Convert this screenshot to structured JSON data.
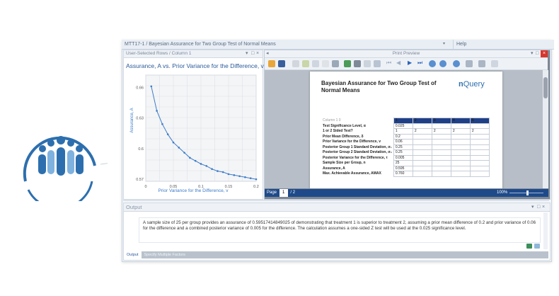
{
  "window": {
    "title": "MTT17-1 / Bayesian Assurance for Two Group Test of Normal Means",
    "help_label": "Help"
  },
  "chart_panel": {
    "header": "User-Selected Rows / Column 1"
  },
  "chart_data": {
    "type": "line",
    "title": "Assurance, A vs. Prior Variance for the Difference, v",
    "xlabel": "Prior Variance for the Difference, v",
    "ylabel": "Assurance, A",
    "xlim": [
      0,
      0.2
    ],
    "ylim": [
      0.568,
      0.672
    ],
    "x_ticks": [
      "0",
      "0.05",
      "0.1",
      "0.15",
      "0.2"
    ],
    "y_ticks": [
      "0.57",
      "0.6",
      "0.63",
      "0.66"
    ],
    "x": [
      0.01,
      0.02,
      0.03,
      0.04,
      0.05,
      0.06,
      0.07,
      0.08,
      0.09,
      0.1,
      0.11,
      0.12,
      0.13,
      0.14,
      0.15,
      0.16,
      0.17,
      0.18,
      0.19,
      0.2
    ],
    "series": [
      {
        "values": [
          0.661,
          0.637,
          0.624,
          0.614,
          0.606,
          0.601,
          0.596,
          0.591,
          0.588,
          0.585,
          0.583,
          0.58,
          0.578,
          0.577,
          0.575,
          0.574,
          0.573,
          0.572,
          0.571,
          0.57
        ]
      }
    ],
    "grid": true,
    "color": "#3d7cc9"
  },
  "preview": {
    "header": "Print Preview",
    "doc_title": "Bayesian Assurance for Two Group Test of Normal Means",
    "logo": {
      "n": "n",
      "rest": "Query"
    },
    "col_header_label": "Column 1 0",
    "columns": [
      "1",
      "2",
      "3",
      "4",
      "5"
    ],
    "rows": [
      {
        "label": "Test Significance Level, α",
        "values": [
          "0.025",
          "",
          "",
          "",
          ""
        ]
      },
      {
        "label": "1 or 2 Sided Test?",
        "values": [
          "1",
          "2",
          "2",
          "2",
          "2"
        ]
      },
      {
        "label": "Prior Mean Difference, δ",
        "values": [
          "0.2",
          "",
          "",
          "",
          ""
        ]
      },
      {
        "label": "Prior Variance for the Difference, v",
        "values": [
          "0.06",
          "",
          "",
          "",
          ""
        ]
      },
      {
        "label": "Posterior Group 1 Standard Deviation, σ₁",
        "values": [
          "0.25",
          "",
          "",
          "",
          ""
        ]
      },
      {
        "label": "Posterior Group 2 Standard Deviation, σ₂",
        "values": [
          "0.25",
          "",
          "",
          "",
          ""
        ]
      },
      {
        "label": "Posterior Variance for the Difference, τ",
        "values": [
          "0.005",
          "",
          "",
          "",
          ""
        ]
      },
      {
        "label": "Sample Size per Group, n",
        "values": [
          "25",
          "",
          "",
          "",
          ""
        ]
      },
      {
        "label": "Assurance, A",
        "values": [
          "0.595",
          "",
          "",
          "",
          ""
        ]
      },
      {
        "label": "Max. Achievable Assurance, AMAX",
        "values": [
          "0.760",
          "",
          "",
          "",
          ""
        ]
      }
    ],
    "page_label": "Page",
    "page_value": "1",
    "page_total": "/ 2",
    "zoom": "100%"
  },
  "output": {
    "header": "Output",
    "text": "A sample size of 25 per group provides an assurance of 0.59517414849025 of demonstrating that treatment 1 is superior to treatment 2, assuming a prior mean difference of 0.2 and prior variance of 0.06 for the difference and a combined posterior variance of 0.005 for the difference. The calculation assumes a one-sided Z test will be used at the 0.025 significance level.",
    "tab_output": "Output",
    "tab_factors": "Specify Multiple Factors"
  },
  "colors": {
    "brand_blue": "#2d6fae",
    "header_navy": "#1f3f87",
    "series": "#3d7cc9"
  }
}
